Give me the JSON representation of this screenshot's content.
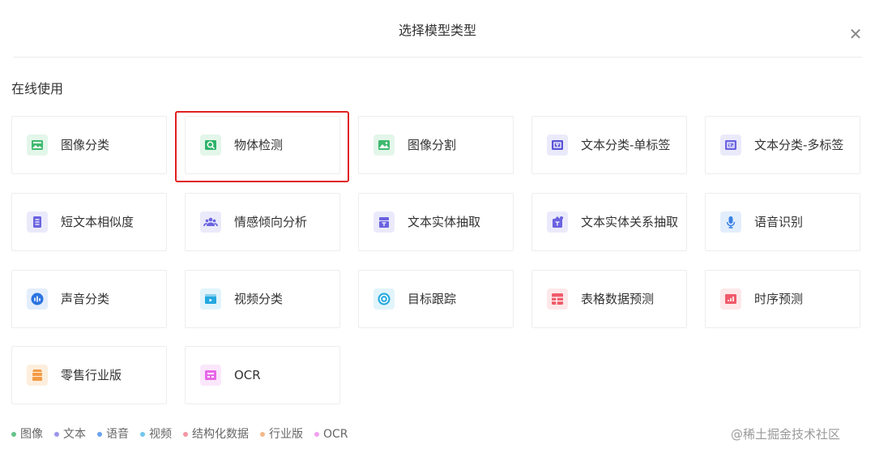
{
  "dialog": {
    "title": "选择模型类型"
  },
  "section": {
    "title": "在线使用"
  },
  "cards": [
    {
      "label": "图像分类",
      "icon": "image-classify-icon",
      "color": "#3fb96f",
      "bg": "#e3f6ea"
    },
    {
      "label": "物体检测",
      "icon": "object-detect-icon",
      "color": "#2fb36a",
      "bg": "#e3f6ea",
      "selected": true
    },
    {
      "label": "图像分割",
      "icon": "image-segment-icon",
      "color": "#3fb96f",
      "bg": "#e3f6ea"
    },
    {
      "label": "文本分类-单标签",
      "icon": "text-classify-single-icon",
      "color": "#5b55d9",
      "bg": "#ebeafb"
    },
    {
      "label": "文本分类-多标签",
      "icon": "text-classify-multi-icon",
      "color": "#6a63e0",
      "bg": "#ebeafb"
    },
    {
      "label": "短文本相似度",
      "icon": "short-text-similarity-icon",
      "color": "#6a63e0",
      "bg": "#ebeafb"
    },
    {
      "label": "情感倾向分析",
      "icon": "sentiment-analysis-icon",
      "color": "#6a63e0",
      "bg": "#ebeafb"
    },
    {
      "label": "文本实体抽取",
      "icon": "text-entity-extract-icon",
      "color": "#6a63e0",
      "bg": "#ebeafb"
    },
    {
      "label": "文本实体关系抽取",
      "icon": "text-relation-extract-icon",
      "color": "#6a63e0",
      "bg": "#ebeafb"
    },
    {
      "label": "语音识别",
      "icon": "microphone-icon",
      "color": "#3b82e6",
      "bg": "#e3eefc"
    },
    {
      "label": "声音分类",
      "icon": "sound-classify-icon",
      "color": "#2a73e0",
      "bg": "#e3eefc"
    },
    {
      "label": "视频分类",
      "icon": "video-classify-icon",
      "color": "#24a8e0",
      "bg": "#e2f4fb"
    },
    {
      "label": "目标跟踪",
      "icon": "target-tracking-icon",
      "color": "#24a8e0",
      "bg": "#e2f4fb"
    },
    {
      "label": "表格数据预测",
      "icon": "table-data-predict-icon",
      "color": "#f05a6a",
      "bg": "#fde8ea"
    },
    {
      "label": "时序预测",
      "icon": "time-series-predict-icon",
      "color": "#f05a6a",
      "bg": "#fde8ea"
    },
    {
      "label": "零售行业版",
      "icon": "retail-icon",
      "color": "#f39c45",
      "bg": "#fdeedd"
    },
    {
      "label": "OCR",
      "icon": "ocr-icon",
      "color": "#e868e8",
      "bg": "#fbe7fb"
    }
  ],
  "legend": [
    {
      "label": "图像",
      "color": "#66c28a"
    },
    {
      "label": "文本",
      "color": "#9b96ea"
    },
    {
      "label": "语音",
      "color": "#6aa3ee"
    },
    {
      "label": "视频",
      "color": "#72c6ea"
    },
    {
      "label": "结构化数据",
      "color": "#f598a3"
    },
    {
      "label": "行业版",
      "color": "#f5b98a"
    },
    {
      "label": "OCR",
      "color": "#f0a0f0"
    }
  ],
  "watermark": "@稀土掘金技术社区"
}
